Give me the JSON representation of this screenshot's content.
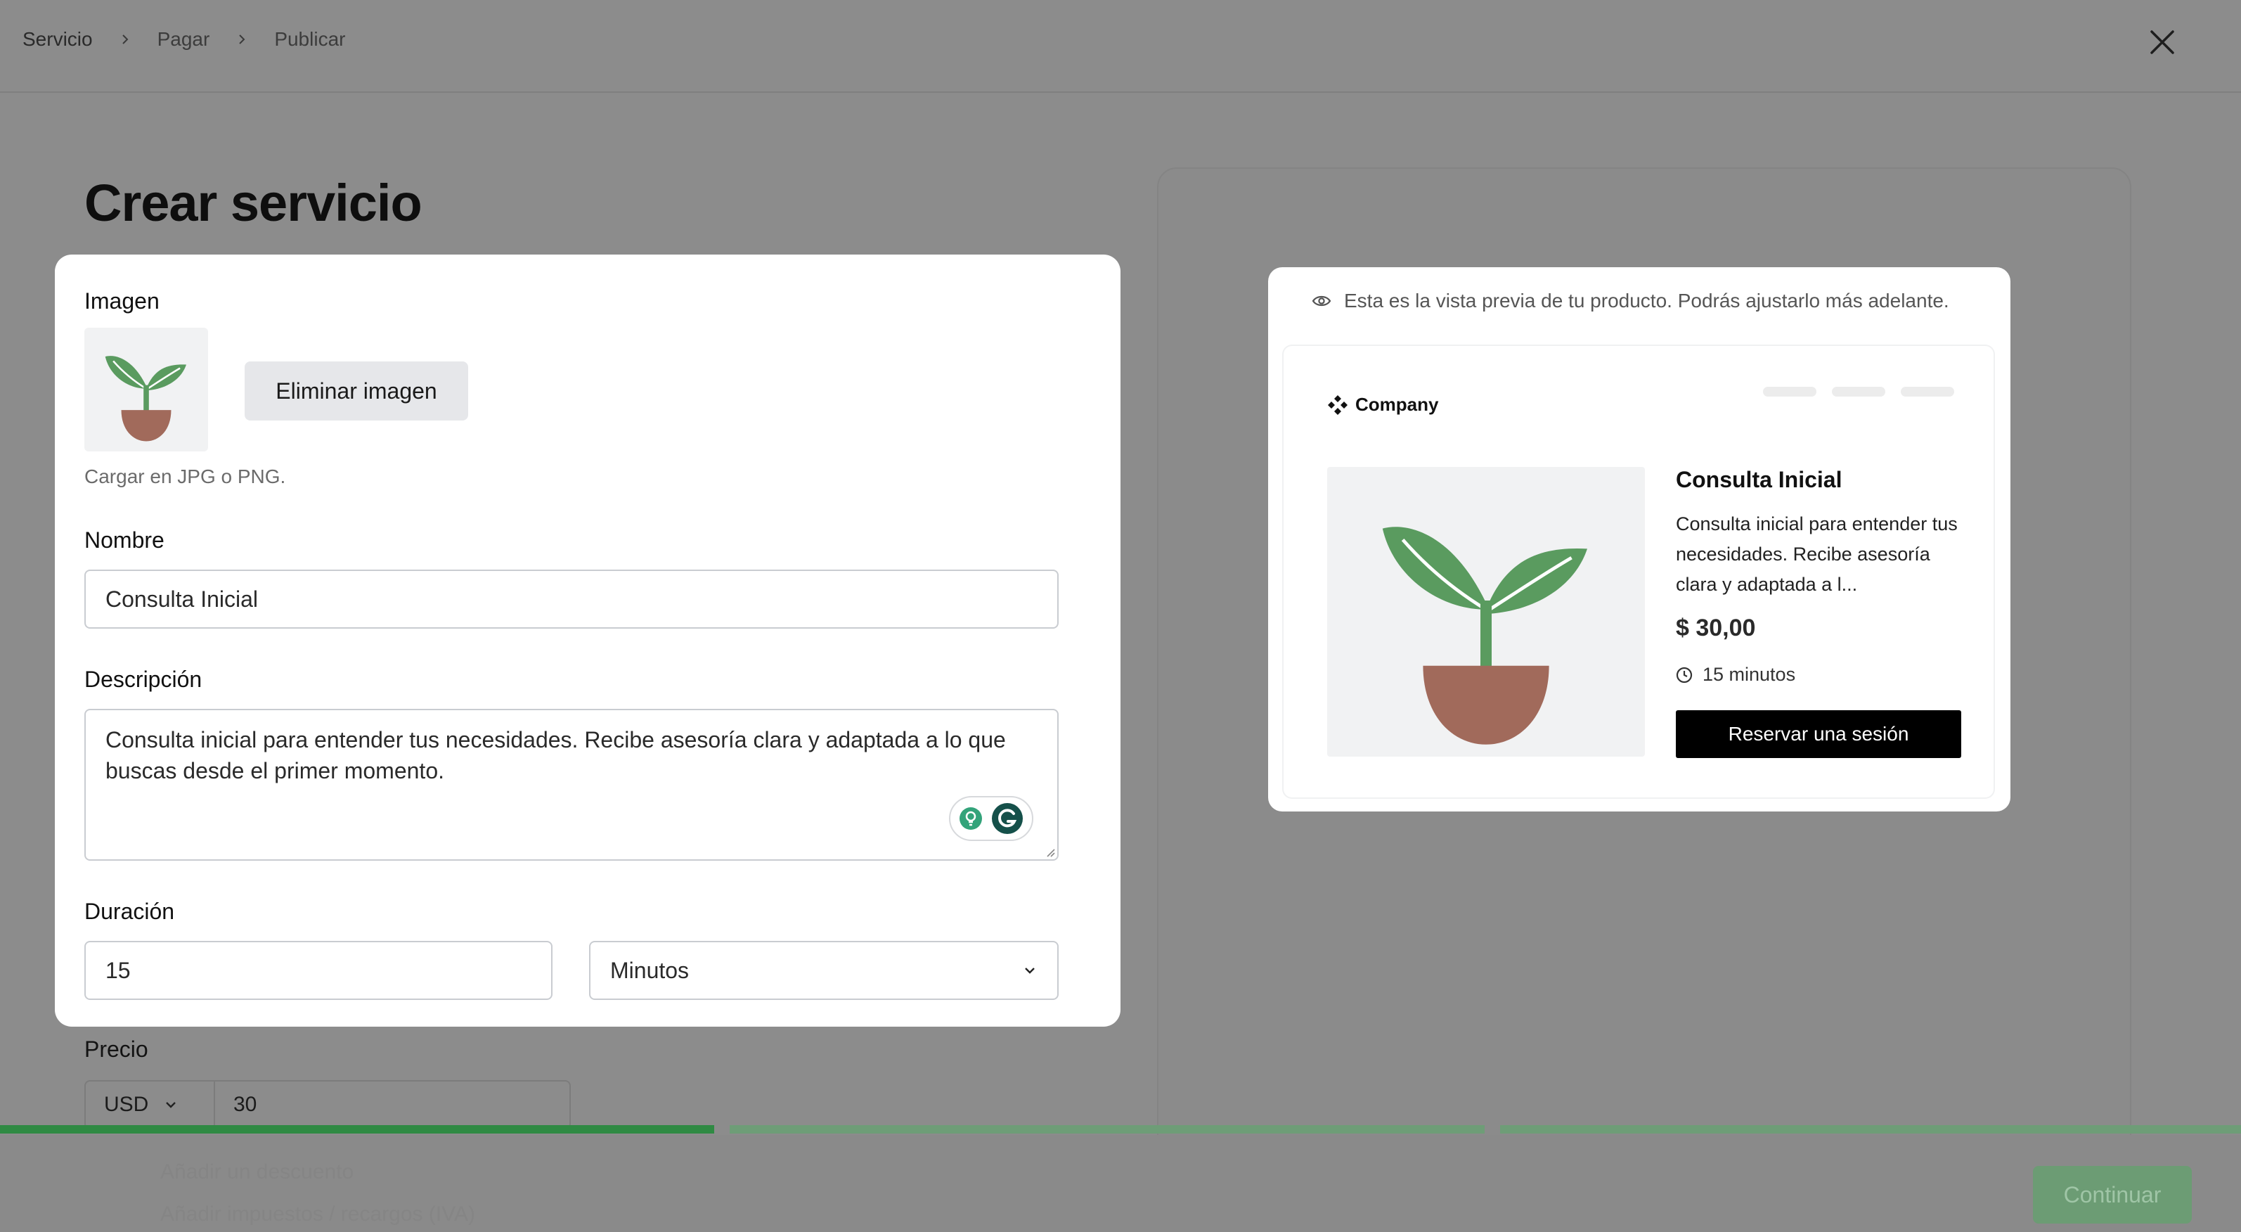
{
  "breadcrumb": {
    "step1": "Servicio",
    "step2": "Pagar",
    "step3": "Publicar"
  },
  "page_title": "Crear servicio",
  "form": {
    "image_label": "Imagen",
    "remove_image_label": "Eliminar imagen",
    "image_hint": "Cargar en JPG o PNG.",
    "name_label": "Nombre",
    "name_value": "Consulta Inicial",
    "description_label": "Descripción",
    "description_value": "Consulta inicial para entender tus necesidades. Recibe asesoría clara y adaptada a lo que buscas desde el primer momento.",
    "duration_label": "Duración",
    "duration_value": "15",
    "duration_unit": "Minutos",
    "price_label": "Precio",
    "currency": "USD",
    "price_value": "30"
  },
  "preview": {
    "note": "Esta es la vista previa de tu producto. Podrás ajustarlo más adelante.",
    "company": "Company",
    "title": "Consulta Inicial",
    "description": "Consulta inicial para entender tus necesidades. Recibe asesoría clara y adaptada a l...",
    "price": "$ 30,00",
    "duration": "15 minutos",
    "cta": "Reservar una sesión"
  },
  "footer": {
    "ghost_1": "Añadir un descuento",
    "ghost_2": "Añadir impuestos / recargos (IVA)",
    "continue_label": "Continuar"
  },
  "progress": {
    "current_step": 1,
    "total_steps": 3
  },
  "colors": {
    "accent_green": "#2f8a43",
    "plant_leaf": "#5a9b5f",
    "plant_pot": "#a16a5b",
    "overlay_gray": "#8c8c8c"
  }
}
